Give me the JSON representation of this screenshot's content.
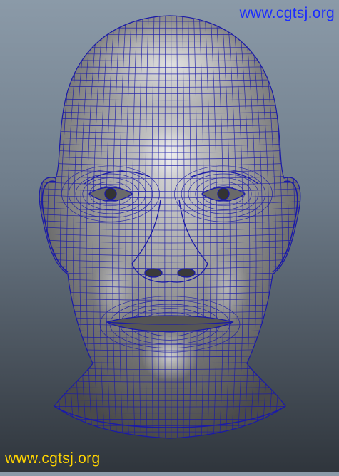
{
  "watermark_top": {
    "text": "www.cgtsj.org",
    "color": "#1b2cff"
  },
  "watermark_bottom": {
    "text": "www.cgtsj.org",
    "color": "#ffd400"
  },
  "model": {
    "subject": "male head",
    "shading": "gray",
    "wireframe_color": "#1a1aa8"
  }
}
